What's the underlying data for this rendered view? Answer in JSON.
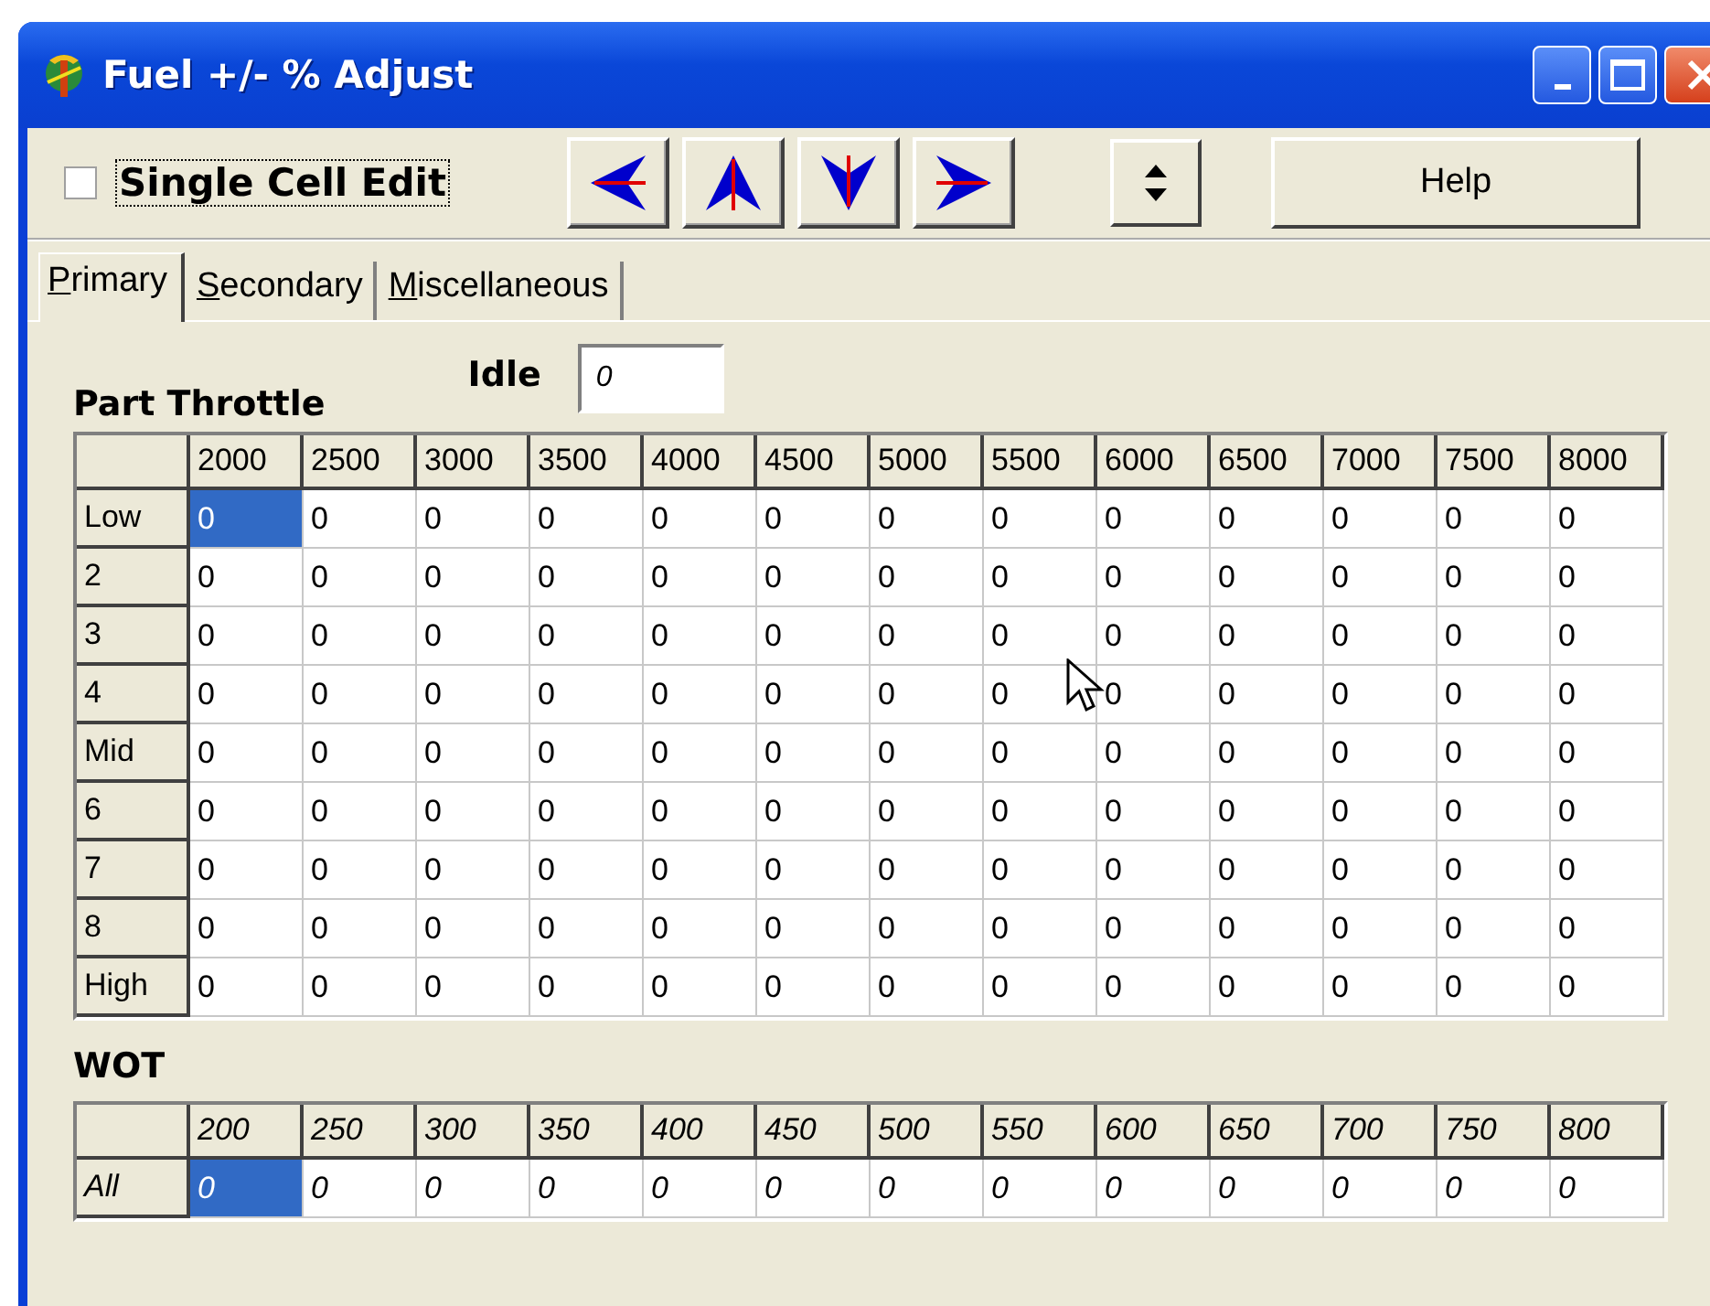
{
  "window": {
    "title": "Fuel +/- % Adjust"
  },
  "toolbar": {
    "single_cell_edit": {
      "label": "Single Cell Edit",
      "checked": false
    },
    "help_button": "Help"
  },
  "tabs": [
    {
      "label": "Primary",
      "selected": true
    },
    {
      "label": "Secondary",
      "selected": false
    },
    {
      "label": "Miscellaneous",
      "selected": false
    }
  ],
  "idle": {
    "label": "Idle",
    "value": "0"
  },
  "part_throttle": {
    "title": "Part Throttle",
    "columns": [
      "2000",
      "2500",
      "3000",
      "3500",
      "4000",
      "4500",
      "5000",
      "5500",
      "6000",
      "6500",
      "7000",
      "7500",
      "8000"
    ],
    "rows": [
      {
        "label": "Low",
        "cells": [
          {
            "value": "0",
            "selected": true
          },
          {
            "value": "0",
            "selected": false
          },
          {
            "value": "0",
            "selected": false
          },
          {
            "value": "0",
            "selected": false
          },
          {
            "value": "0",
            "selected": false
          },
          {
            "value": "0",
            "selected": false
          },
          {
            "value": "0",
            "selected": false
          },
          {
            "value": "0",
            "selected": false
          },
          {
            "value": "0",
            "selected": false
          },
          {
            "value": "0",
            "selected": false
          },
          {
            "value": "0",
            "selected": false
          },
          {
            "value": "0",
            "selected": false
          },
          {
            "value": "0",
            "selected": false
          }
        ]
      },
      {
        "label": "2",
        "cells": [
          {
            "value": "0",
            "selected": false
          },
          {
            "value": "0",
            "selected": false
          },
          {
            "value": "0",
            "selected": false
          },
          {
            "value": "0",
            "selected": false
          },
          {
            "value": "0",
            "selected": false
          },
          {
            "value": "0",
            "selected": false
          },
          {
            "value": "0",
            "selected": false
          },
          {
            "value": "0",
            "selected": false
          },
          {
            "value": "0",
            "selected": false
          },
          {
            "value": "0",
            "selected": false
          },
          {
            "value": "0",
            "selected": false
          },
          {
            "value": "0",
            "selected": false
          },
          {
            "value": "0",
            "selected": false
          }
        ]
      },
      {
        "label": "3",
        "cells": [
          {
            "value": "0",
            "selected": false
          },
          {
            "value": "0",
            "selected": false
          },
          {
            "value": "0",
            "selected": false
          },
          {
            "value": "0",
            "selected": false
          },
          {
            "value": "0",
            "selected": false
          },
          {
            "value": "0",
            "selected": false
          },
          {
            "value": "0",
            "selected": false
          },
          {
            "value": "0",
            "selected": false
          },
          {
            "value": "0",
            "selected": false
          },
          {
            "value": "0",
            "selected": false
          },
          {
            "value": "0",
            "selected": false
          },
          {
            "value": "0",
            "selected": false
          },
          {
            "value": "0",
            "selected": false
          }
        ]
      },
      {
        "label": "4",
        "cells": [
          {
            "value": "0",
            "selected": false
          },
          {
            "value": "0",
            "selected": false
          },
          {
            "value": "0",
            "selected": false
          },
          {
            "value": "0",
            "selected": false
          },
          {
            "value": "0",
            "selected": false
          },
          {
            "value": "0",
            "selected": false
          },
          {
            "value": "0",
            "selected": false
          },
          {
            "value": "0",
            "selected": false
          },
          {
            "value": "0",
            "selected": false
          },
          {
            "value": "0",
            "selected": false
          },
          {
            "value": "0",
            "selected": false
          },
          {
            "value": "0",
            "selected": false
          },
          {
            "value": "0",
            "selected": false
          }
        ]
      },
      {
        "label": "Mid",
        "cells": [
          {
            "value": "0",
            "selected": false
          },
          {
            "value": "0",
            "selected": false
          },
          {
            "value": "0",
            "selected": false
          },
          {
            "value": "0",
            "selected": false
          },
          {
            "value": "0",
            "selected": false
          },
          {
            "value": "0",
            "selected": false
          },
          {
            "value": "0",
            "selected": false
          },
          {
            "value": "0",
            "selected": false
          },
          {
            "value": "0",
            "selected": false
          },
          {
            "value": "0",
            "selected": false
          },
          {
            "value": "0",
            "selected": false
          },
          {
            "value": "0",
            "selected": false
          },
          {
            "value": "0",
            "selected": false
          }
        ]
      },
      {
        "label": "6",
        "cells": [
          {
            "value": "0",
            "selected": false
          },
          {
            "value": "0",
            "selected": false
          },
          {
            "value": "0",
            "selected": false
          },
          {
            "value": "0",
            "selected": false
          },
          {
            "value": "0",
            "selected": false
          },
          {
            "value": "0",
            "selected": false
          },
          {
            "value": "0",
            "selected": false
          },
          {
            "value": "0",
            "selected": false
          },
          {
            "value": "0",
            "selected": false
          },
          {
            "value": "0",
            "selected": false
          },
          {
            "value": "0",
            "selected": false
          },
          {
            "value": "0",
            "selected": false
          },
          {
            "value": "0",
            "selected": false
          }
        ]
      },
      {
        "label": "7",
        "cells": [
          {
            "value": "0",
            "selected": false
          },
          {
            "value": "0",
            "selected": false
          },
          {
            "value": "0",
            "selected": false
          },
          {
            "value": "0",
            "selected": false
          },
          {
            "value": "0",
            "selected": false
          },
          {
            "value": "0",
            "selected": false
          },
          {
            "value": "0",
            "selected": false
          },
          {
            "value": "0",
            "selected": false
          },
          {
            "value": "0",
            "selected": false
          },
          {
            "value": "0",
            "selected": false
          },
          {
            "value": "0",
            "selected": false
          },
          {
            "value": "0",
            "selected": false
          },
          {
            "value": "0",
            "selected": false
          }
        ]
      },
      {
        "label": "8",
        "cells": [
          {
            "value": "0",
            "selected": false
          },
          {
            "value": "0",
            "selected": false
          },
          {
            "value": "0",
            "selected": false
          },
          {
            "value": "0",
            "selected": false
          },
          {
            "value": "0",
            "selected": false
          },
          {
            "value": "0",
            "selected": false
          },
          {
            "value": "0",
            "selected": false
          },
          {
            "value": "0",
            "selected": false
          },
          {
            "value": "0",
            "selected": false
          },
          {
            "value": "0",
            "selected": false
          },
          {
            "value": "0",
            "selected": false
          },
          {
            "value": "0",
            "selected": false
          },
          {
            "value": "0",
            "selected": false
          }
        ]
      },
      {
        "label": "High",
        "cells": [
          {
            "value": "0",
            "selected": false
          },
          {
            "value": "0",
            "selected": false
          },
          {
            "value": "0",
            "selected": false
          },
          {
            "value": "0",
            "selected": false
          },
          {
            "value": "0",
            "selected": false
          },
          {
            "value": "0",
            "selected": false
          },
          {
            "value": "0",
            "selected": false
          },
          {
            "value": "0",
            "selected": false
          },
          {
            "value": "0",
            "selected": false
          },
          {
            "value": "0",
            "selected": false
          },
          {
            "value": "0",
            "selected": false
          },
          {
            "value": "0",
            "selected": false
          },
          {
            "value": "0",
            "selected": false
          }
        ]
      }
    ]
  },
  "wot": {
    "title": "WOT",
    "columns": [
      "200",
      "250",
      "300",
      "350",
      "400",
      "450",
      "500",
      "550",
      "600",
      "650",
      "700",
      "750",
      "800"
    ],
    "rows": [
      {
        "label": "All",
        "cells": [
          {
            "value": "0",
            "selected": true
          },
          {
            "value": "0",
            "selected": false
          },
          {
            "value": "0",
            "selected": false
          },
          {
            "value": "0",
            "selected": false
          },
          {
            "value": "0",
            "selected": false
          },
          {
            "value": "0",
            "selected": false
          },
          {
            "value": "0",
            "selected": false
          },
          {
            "value": "0",
            "selected": false
          },
          {
            "value": "0",
            "selected": false
          },
          {
            "value": "0",
            "selected": false
          },
          {
            "value": "0",
            "selected": false
          },
          {
            "value": "0",
            "selected": false
          },
          {
            "value": "0",
            "selected": false
          }
        ]
      }
    ]
  }
}
